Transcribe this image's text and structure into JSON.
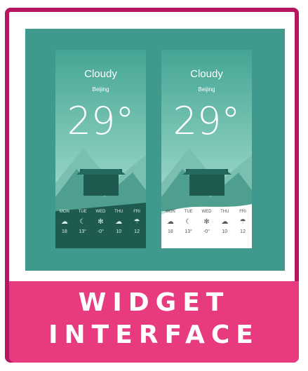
{
  "banner": {
    "line1": "WIDGET",
    "line2": "INTERFACE"
  },
  "cards": [
    {
      "condition": "Cloudy",
      "city": "Beijing",
      "temperature": "29°",
      "forecast": [
        {
          "day": "MON",
          "icon": "snow-cloud-icon",
          "temp": "18"
        },
        {
          "day": "TUE",
          "icon": "cloud-moon-icon",
          "temp": "13°"
        },
        {
          "day": "WED",
          "icon": "gear-snow-icon",
          "temp": "-0°"
        },
        {
          "day": "THU",
          "icon": "cloud-icon",
          "temp": "10"
        },
        {
          "day": "FRI",
          "icon": "cloud-rain-icon",
          "temp": "12"
        }
      ]
    },
    {
      "condition": "Cloudy",
      "city": "Beijing",
      "temperature": "29°",
      "forecast": [
        {
          "day": "MON",
          "icon": "snow-cloud-icon",
          "temp": "18"
        },
        {
          "day": "TUE",
          "icon": "cloud-moon-icon",
          "temp": "13°"
        },
        {
          "day": "WED",
          "icon": "gear-snow-icon",
          "temp": "-0°"
        },
        {
          "day": "THU",
          "icon": "cloud-icon",
          "temp": "10"
        },
        {
          "day": "FRI",
          "icon": "cloud-rain-icon",
          "temp": "12"
        }
      ]
    }
  ],
  "colors": {
    "frame": "#b5165f",
    "banner": "#e83a7e",
    "teal": "#3f9a8d",
    "dark_panel": "#1f5a50"
  }
}
